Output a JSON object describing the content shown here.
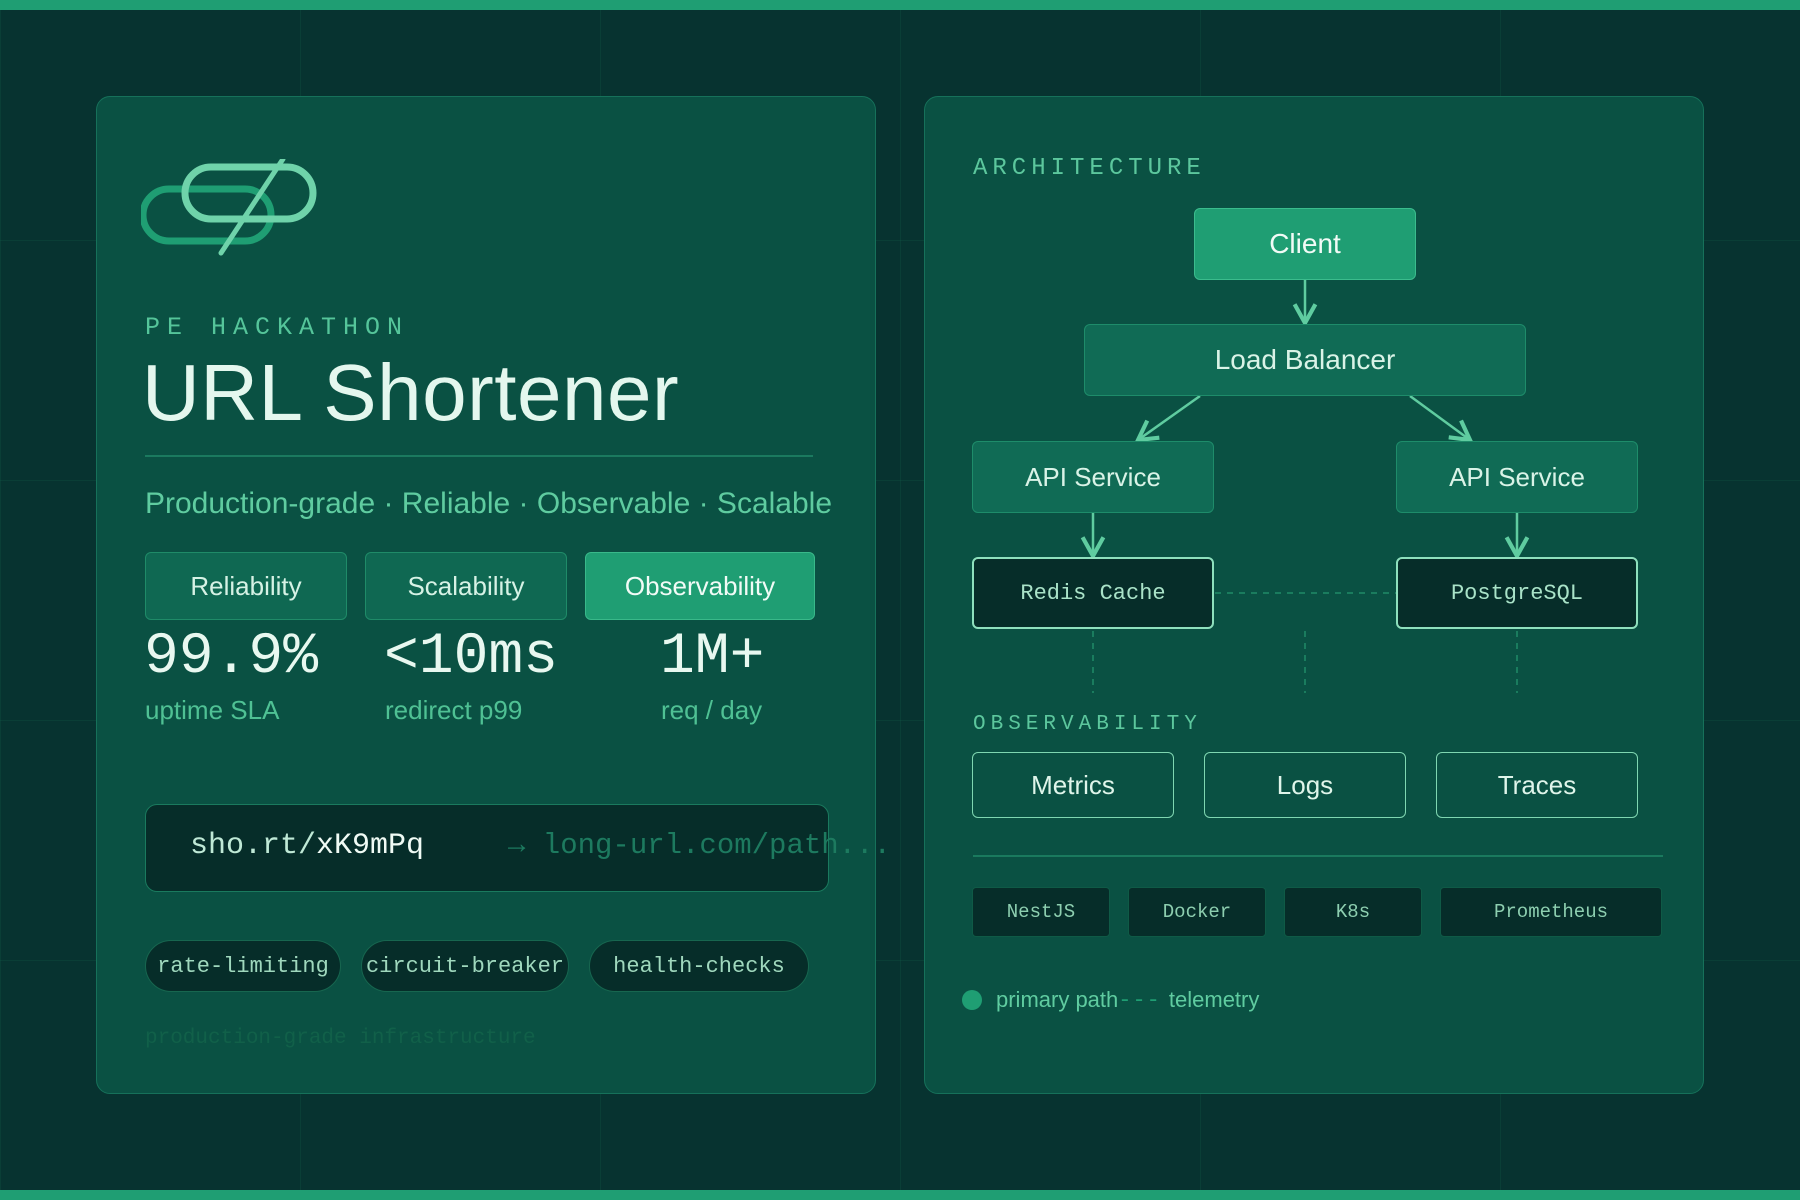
{
  "theme": {
    "background": "#073330",
    "card": "#0a5143",
    "accent": "#1f9e73",
    "accent_light": "#5fcca0",
    "text": "#e4f7ee"
  },
  "hero": {
    "logo_icon": "link-icon",
    "kicker": "PE HACKATHON",
    "title": "URL Shortener",
    "tagline": "Production-grade · Reliable · Observable · Scalable",
    "pillars": [
      {
        "label": "Reliability",
        "active": false
      },
      {
        "label": "Scalability",
        "active": false
      },
      {
        "label": "Observability",
        "active": true
      }
    ],
    "stats": [
      {
        "value": "99.9%",
        "label": "uptime SLA"
      },
      {
        "value": "<10ms",
        "label": "redirect p99"
      },
      {
        "value": "1M+",
        "label": "req / day"
      }
    ],
    "url_example": {
      "domain": "sho.rt/",
      "code": "xK9mPq",
      "target": "→ long-url.com/path..."
    },
    "features": [
      "rate-limiting",
      "circuit-breaker",
      "health-checks"
    ],
    "footnote": "production-grade infrastructure"
  },
  "architecture": {
    "section_label": "ARCHITECTURE",
    "nodes": {
      "client": "Client",
      "load_balancer": "Load Balancer",
      "api_left": "API Service",
      "api_right": "API Service",
      "cache": "Redis Cache",
      "database": "PostgreSQL"
    },
    "observability_label": "OBSERVABILITY",
    "observability_items": [
      "Metrics",
      "Logs",
      "Traces"
    ],
    "tech_stack": [
      "NestJS",
      "Docker",
      "K8s",
      "Prometheus"
    ],
    "legend": {
      "primary": "primary path",
      "dash": "---",
      "telemetry": "telemetry"
    }
  }
}
